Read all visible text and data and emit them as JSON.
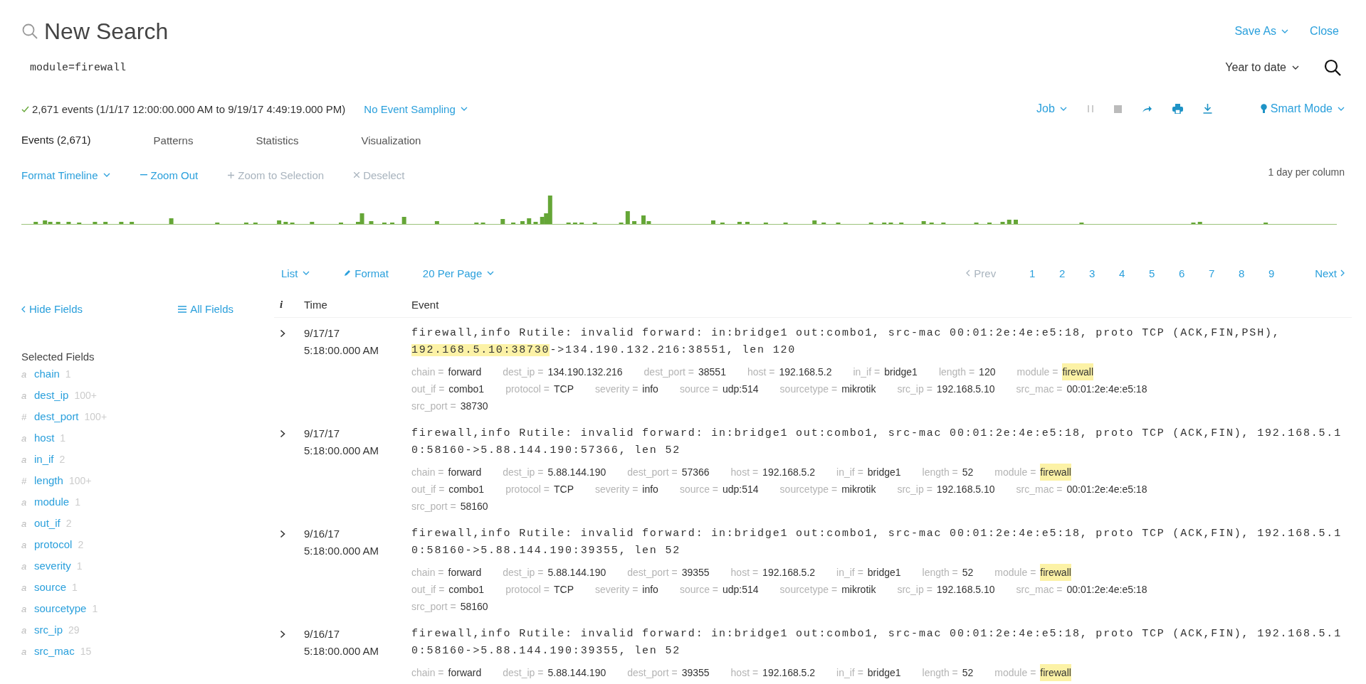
{
  "header": {
    "title": "New Search",
    "links": [
      {
        "label": "Save As",
        "dropdown": true
      },
      {
        "label": "Close",
        "dropdown": false
      }
    ]
  },
  "search": {
    "value": "module=firewall",
    "time_range": "Year to date"
  },
  "job_bar": {
    "summary": "2,671 events (1/1/17 12:00:00.000 AM to 9/19/17 4:49:19.000 PM)",
    "complete": true,
    "sampling": "No Event Sampling",
    "job": "Job",
    "mode": "Smart Mode"
  },
  "tabs": [
    {
      "label": "Events (2,671)",
      "selected": true
    },
    {
      "label": "Patterns",
      "selected": false
    },
    {
      "label": "Statistics",
      "selected": false
    },
    {
      "label": "Visualization",
      "selected": false
    }
  ],
  "timeline": {
    "actions": [
      {
        "label": "Format Timeline",
        "kind": "dropdown",
        "disabled": false
      },
      {
        "label": "Zoom Out",
        "kind": "minus",
        "disabled": false
      },
      {
        "label": "Zoom to Selection",
        "kind": "plus",
        "disabled": true
      },
      {
        "label": "Deselect",
        "kind": "cross",
        "disabled": true
      }
    ],
    "scale": "1 day per column"
  },
  "results_bar": {
    "view": "List",
    "format": "Format",
    "per_page": "20 Per Page",
    "prev": {
      "label": "Prev",
      "disabled": true
    },
    "pages": [
      {
        "label": "1",
        "selected": false
      },
      {
        "label": "2",
        "selected": false
      },
      {
        "label": "3",
        "selected": false
      },
      {
        "label": "4",
        "selected": false
      },
      {
        "label": "5",
        "selected": false
      },
      {
        "label": "6",
        "selected": false
      },
      {
        "label": "7",
        "selected": false
      },
      {
        "label": "8",
        "selected": false
      },
      {
        "label": "9",
        "selected": false
      }
    ],
    "next": "Next"
  },
  "sidebar": {
    "hide": "Hide Fields",
    "all": "All Fields",
    "heading": "Selected Fields",
    "fields": [
      {
        "type": "a",
        "name": "chain",
        "count": "1"
      },
      {
        "type": "a",
        "name": "dest_ip",
        "count": "100+"
      },
      {
        "type": "#",
        "name": "dest_port",
        "count": "100+"
      },
      {
        "type": "a",
        "name": "host",
        "count": "1"
      },
      {
        "type": "a",
        "name": "in_if",
        "count": "2"
      },
      {
        "type": "#",
        "name": "length",
        "count": "100+"
      },
      {
        "type": "a",
        "name": "module",
        "count": "1"
      },
      {
        "type": "a",
        "name": "out_if",
        "count": "2"
      },
      {
        "type": "a",
        "name": "protocol",
        "count": "2"
      },
      {
        "type": "a",
        "name": "severity",
        "count": "1"
      },
      {
        "type": "a",
        "name": "source",
        "count": "1"
      },
      {
        "type": "a",
        "name": "sourcetype",
        "count": "1"
      },
      {
        "type": "a",
        "name": "src_ip",
        "count": "29"
      },
      {
        "type": "a",
        "name": "src_mac",
        "count": "15"
      }
    ]
  },
  "table": {
    "columns": [
      "i",
      "Time",
      "Event"
    ],
    "events": [
      {
        "date": "9/17/17",
        "time": "5:18:00.000 AM",
        "lines": [
          [
            {
              "text": "firewall,info Rutile: invalid forward: in:bridge1 out:combo1, src-mac 00:01:2e:4e:e5:18, proto TCP (ACK,FIN,PSH),",
              "highlighted": false
            }
          ],
          [
            {
              "text": "192.168.5.10:38730",
              "highlighted": true
            },
            {
              "text": "->134.190.132.216:38551, len 120",
              "highlighted": false
            }
          ]
        ],
        "field_rows": [
          [
            {
              "key": "chain =",
              "value": "forward",
              "highlighted": false
            },
            {
              "key": "dest_ip =",
              "value": "134.190.132.216",
              "highlighted": false
            },
            {
              "key": "dest_port =",
              "value": "38551",
              "highlighted": false
            },
            {
              "key": "host =",
              "value": "192.168.5.2",
              "highlighted": false
            },
            {
              "key": "in_if =",
              "value": "bridge1",
              "highlighted": false
            },
            {
              "key": "length =",
              "value": "120",
              "highlighted": false
            },
            {
              "key": "module =",
              "value": "firewall",
              "highlighted": true
            }
          ],
          [
            {
              "key": "out_if =",
              "value": "combo1",
              "highlighted": false
            },
            {
              "key": "protocol =",
              "value": "TCP",
              "highlighted": false
            },
            {
              "key": "severity =",
              "value": "info",
              "highlighted": false
            },
            {
              "key": "source =",
              "value": "udp:514",
              "highlighted": false
            },
            {
              "key": "sourcetype =",
              "value": "mikrotik",
              "highlighted": false
            },
            {
              "key": "src_ip =",
              "value": "192.168.5.10",
              "highlighted": false
            },
            {
              "key": "src_mac =",
              "value": "00:01:2e:4e:e5:18",
              "highlighted": false
            }
          ],
          [
            {
              "key": "src_port =",
              "value": "38730",
              "highlighted": false
            }
          ]
        ]
      },
      {
        "date": "9/17/17",
        "time": "5:18:00.000 AM",
        "lines": [
          [
            {
              "text": "firewall,info Rutile: invalid forward: in:bridge1 out:combo1, src-mac 00:01:2e:4e:e5:18, proto TCP (ACK,FIN), 192.168.5.1",
              "highlighted": false
            }
          ],
          [
            {
              "text": "0:58160->5.88.144.190:57366, len 52",
              "highlighted": false
            }
          ]
        ],
        "field_rows": [
          [
            {
              "key": "chain =",
              "value": "forward",
              "highlighted": false
            },
            {
              "key": "dest_ip =",
              "value": "5.88.144.190",
              "highlighted": false
            },
            {
              "key": "dest_port =",
              "value": "57366",
              "highlighted": false
            },
            {
              "key": "host =",
              "value": "192.168.5.2",
              "highlighted": false
            },
            {
              "key": "in_if =",
              "value": "bridge1",
              "highlighted": false
            },
            {
              "key": "length =",
              "value": "52",
              "highlighted": false
            },
            {
              "key": "module =",
              "value": "firewall",
              "highlighted": true
            }
          ],
          [
            {
              "key": "out_if =",
              "value": "combo1",
              "highlighted": false
            },
            {
              "key": "protocol =",
              "value": "TCP",
              "highlighted": false
            },
            {
              "key": "severity =",
              "value": "info",
              "highlighted": false
            },
            {
              "key": "source =",
              "value": "udp:514",
              "highlighted": false
            },
            {
              "key": "sourcetype =",
              "value": "mikrotik",
              "highlighted": false
            },
            {
              "key": "src_ip =",
              "value": "192.168.5.10",
              "highlighted": false
            },
            {
              "key": "src_mac =",
              "value": "00:01:2e:4e:e5:18",
              "highlighted": false
            }
          ],
          [
            {
              "key": "src_port =",
              "value": "58160",
              "highlighted": false
            }
          ]
        ]
      },
      {
        "date": "9/16/17",
        "time": "5:18:00.000 AM",
        "lines": [
          [
            {
              "text": "firewall,info Rutile: invalid forward: in:bridge1 out:combo1, src-mac 00:01:2e:4e:e5:18, proto TCP (ACK,FIN), 192.168.5.1",
              "highlighted": false
            }
          ],
          [
            {
              "text": "0:58160->5.88.144.190:39355, len 52",
              "highlighted": false
            }
          ]
        ],
        "field_rows": [
          [
            {
              "key": "chain =",
              "value": "forward",
              "highlighted": false
            },
            {
              "key": "dest_ip =",
              "value": "5.88.144.190",
              "highlighted": false
            },
            {
              "key": "dest_port =",
              "value": "39355",
              "highlighted": false
            },
            {
              "key": "host =",
              "value": "192.168.5.2",
              "highlighted": false
            },
            {
              "key": "in_if =",
              "value": "bridge1",
              "highlighted": false
            },
            {
              "key": "length =",
              "value": "52",
              "highlighted": false
            },
            {
              "key": "module =",
              "value": "firewall",
              "highlighted": true
            }
          ],
          [
            {
              "key": "out_if =",
              "value": "combo1",
              "highlighted": false
            },
            {
              "key": "protocol =",
              "value": "TCP",
              "highlighted": false
            },
            {
              "key": "severity =",
              "value": "info",
              "highlighted": false
            },
            {
              "key": "source =",
              "value": "udp:514",
              "highlighted": false
            },
            {
              "key": "sourcetype =",
              "value": "mikrotik",
              "highlighted": false
            },
            {
              "key": "src_ip =",
              "value": "192.168.5.10",
              "highlighted": false
            },
            {
              "key": "src_mac =",
              "value": "00:01:2e:4e:e5:18",
              "highlighted": false
            }
          ],
          [
            {
              "key": "src_port =",
              "value": "58160",
              "highlighted": false
            }
          ]
        ]
      },
      {
        "date": "9/16/17",
        "time": "5:18:00.000 AM",
        "lines": [
          [
            {
              "text": "firewall,info Rutile: invalid forward: in:bridge1 out:combo1, src-mac 00:01:2e:4e:e5:18, proto TCP (ACK,FIN), 192.168.5.1",
              "highlighted": false
            }
          ],
          [
            {
              "text": "0:58160->5.88.144.190:39355, len 52",
              "highlighted": false
            }
          ]
        ],
        "field_rows": [
          [
            {
              "key": "chain =",
              "value": "forward",
              "highlighted": false
            },
            {
              "key": "dest_ip =",
              "value": "5.88.144.190",
              "highlighted": false
            },
            {
              "key": "dest_port =",
              "value": "39355",
              "highlighted": false
            },
            {
              "key": "host =",
              "value": "192.168.5.2",
              "highlighted": false
            },
            {
              "key": "in_if =",
              "value": "bridge1",
              "highlighted": false
            },
            {
              "key": "length =",
              "value": "52",
              "highlighted": false
            },
            {
              "key": "module =",
              "value": "firewall",
              "highlighted": true
            }
          ]
        ]
      }
    ]
  }
}
